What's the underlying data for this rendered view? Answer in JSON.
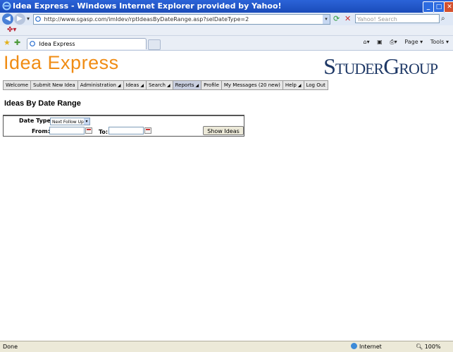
{
  "window": {
    "title": "Idea Express - Windows Internet Explorer provided by Yahoo!",
    "buttons": [
      "_",
      "□",
      "✕"
    ]
  },
  "addressbar": {
    "url": "http://www.sgasp.com/imIdev/rptIdeasByDateRange.asp?selDateType=2",
    "search_placeholder": "Yahoo! Search"
  },
  "tabs": [
    {
      "label": "Idea Express"
    }
  ],
  "commandbar": {
    "page": "Page ▾",
    "tools": "Tools ▾"
  },
  "site": {
    "logo_left": "Idea Express",
    "logo_right": "StuderGroup"
  },
  "menu": [
    {
      "label": "Welcome",
      "arrow": ""
    },
    {
      "label": "Submit New Idea",
      "arrow": ""
    },
    {
      "label": "Administration",
      "arrow": "◢"
    },
    {
      "label": "Ideas",
      "arrow": "◢"
    },
    {
      "label": "Search",
      "arrow": "◢"
    },
    {
      "label": "Reports",
      "arrow": "◢"
    },
    {
      "label": "Profile",
      "arrow": ""
    },
    {
      "label": "My Messages (20 new)",
      "arrow": ""
    },
    {
      "label": "Help",
      "arrow": "◢"
    },
    {
      "label": "Log Out",
      "arrow": ""
    }
  ],
  "page": {
    "title": "Ideas By Date Range"
  },
  "form": {
    "date_type_label": "Date Type:",
    "date_type_value": "Next Follow Up",
    "from_label": "From:",
    "to_label": "To:",
    "from_value": "",
    "to_value": "",
    "show_button": "Show Ideas"
  },
  "statusbar": {
    "left": "Done",
    "zone": "Internet",
    "zoom": "100%"
  },
  "colors": {
    "titlebar": "#1a4bb9",
    "logo_orange": "#f08c14",
    "logo_navy": "#1e3866"
  }
}
